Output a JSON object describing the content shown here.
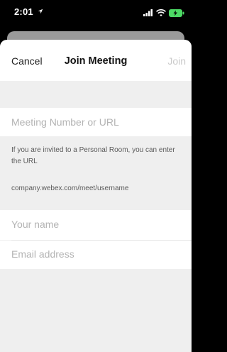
{
  "status_bar": {
    "time": "2:01",
    "time_icon": "location-arrow-icon",
    "icons": [
      "signal-icon",
      "wifi-icon",
      "battery-charging-icon"
    ],
    "battery_color": "#4cd964"
  },
  "nav": {
    "cancel_label": "Cancel",
    "title": "Join Meeting",
    "join_label": "Join"
  },
  "form": {
    "meeting_placeholder": "Meeting Number or URL",
    "hint_line1": "If you are invited to a Personal Room, you can enter",
    "hint_line2": "the URL",
    "hint_example": "company.webex.com/meet/username",
    "name_placeholder": "Your name",
    "email_placeholder": "Email address"
  },
  "colors": {
    "background": "#efefef",
    "field": "#ffffff",
    "disabled_text": "#c9c9c9",
    "placeholder": "#b3b3b3"
  }
}
